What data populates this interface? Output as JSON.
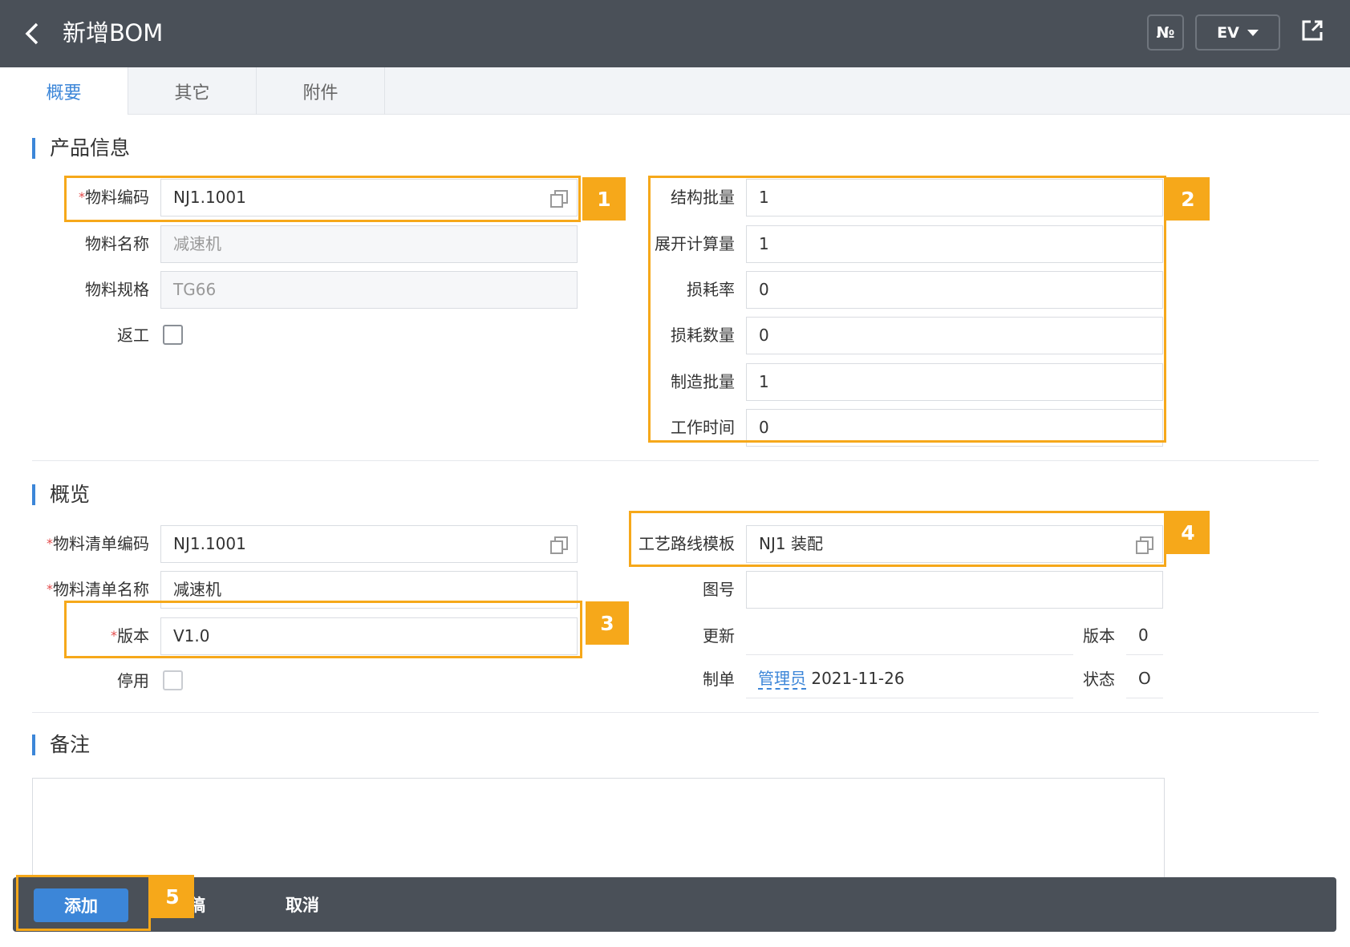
{
  "header": {
    "title": "新增BOM",
    "no_label": "№",
    "ev_label": "EV"
  },
  "tabs": [
    {
      "label": "概要"
    },
    {
      "label": "其它"
    },
    {
      "label": "附件"
    }
  ],
  "product_info": {
    "section_title": "产品信息",
    "material_code_label": "物料编码",
    "material_code": "NJ1.1001",
    "material_name_label": "物料名称",
    "material_name": "减速机",
    "material_spec_label": "物料规格",
    "material_spec": "TG66",
    "rework_label": "返工",
    "struct_qty_label": "结构批量",
    "struct_qty": "1",
    "expand_qty_label": "展开计算量",
    "expand_qty": "1",
    "loss_rate_label": "损耗率",
    "loss_rate": "0",
    "loss_qty_label": "损耗数量",
    "loss_qty": "0",
    "mfg_qty_label": "制造批量",
    "mfg_qty": "1",
    "work_time_label": "工作时间",
    "work_time": "0"
  },
  "overview": {
    "section_title": "概览",
    "bom_code_label": "物料清单编码",
    "bom_code": "NJ1.1001",
    "bom_name_label": "物料清单名称",
    "bom_name": "减速机",
    "version_label": "版本",
    "version": "V1.0",
    "disabled_label": "停用",
    "route_label": "工艺路线模板",
    "route": "NJ1 装配",
    "drawing_label": "图号",
    "drawing": "",
    "update_label": "更新",
    "update": "",
    "ver_label": "版本",
    "ver_value": "0",
    "creator_label": "制单",
    "creator_name": "管理员",
    "creator_date": "2021-11-26",
    "status_label": "状态",
    "status_value": "O"
  },
  "remarks": {
    "section_title": "备注"
  },
  "annotations": [
    "1",
    "2",
    "3",
    "4",
    "5"
  ],
  "footer": {
    "add_label": "添加",
    "draft_label": "草稿",
    "cancel_label": "取消"
  },
  "colors": {
    "header_bg": "#4a5058",
    "accent": "#3c86d8",
    "highlight": "#f6a81a",
    "required": "#e34b4b"
  }
}
